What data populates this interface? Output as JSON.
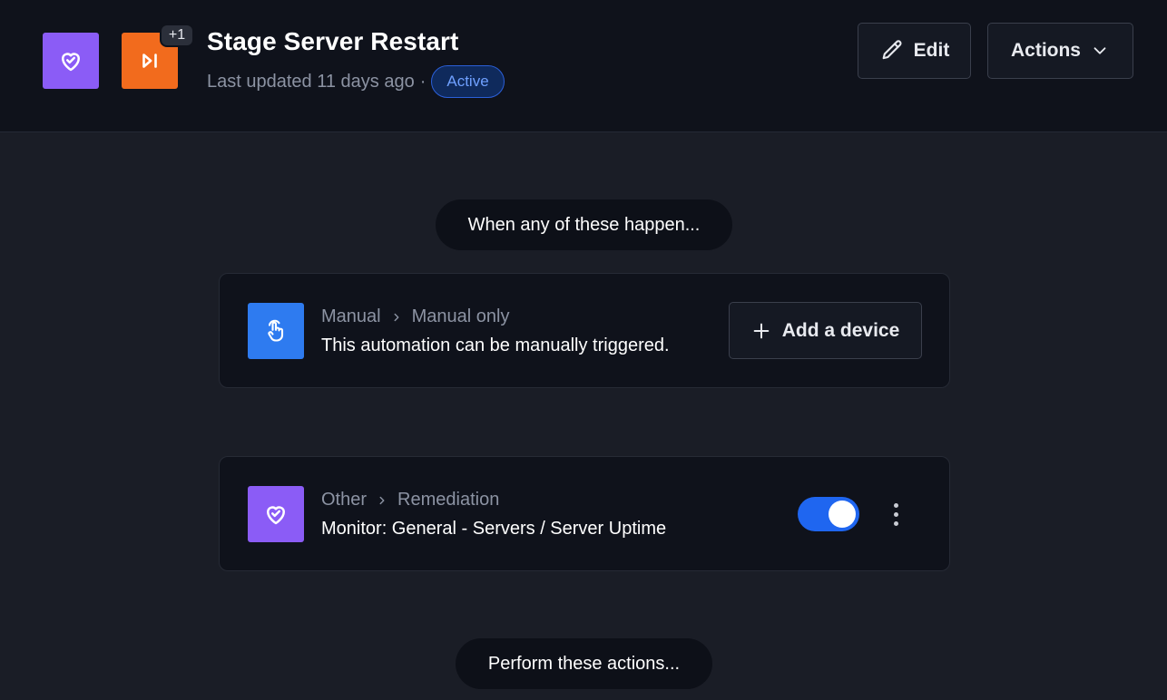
{
  "header": {
    "title": "Stage Server Restart",
    "last_updated": "Last updated 11 days ago",
    "separator": "·",
    "status": "Active",
    "extra_apps_count": "+1",
    "app_icons": [
      "heart-check-icon",
      "skip-forward-icon"
    ],
    "edit_label": "Edit",
    "actions_label": "Actions"
  },
  "sections": {
    "when_label": "When any of these happen...",
    "perform_label": "Perform these actions..."
  },
  "trigger_card": {
    "icon": "touch-icon",
    "category": "Manual",
    "subcategory": "Manual only",
    "description": "This automation can be manually triggered.",
    "add_device_label": "Add a device"
  },
  "monitor_card": {
    "icon": "heart-check-icon",
    "category": "Other",
    "subcategory": "Remediation",
    "description": "Monitor: General - Servers / Server Uptime",
    "enabled": true
  },
  "colors": {
    "background": "#1a1d26",
    "header_bg": "#0f121b",
    "purple": "#8b5cf6",
    "orange": "#f26b1d",
    "blue": "#2e7bf0",
    "toggle_on": "#1f66f0",
    "status_text": "#6fa0ff"
  }
}
